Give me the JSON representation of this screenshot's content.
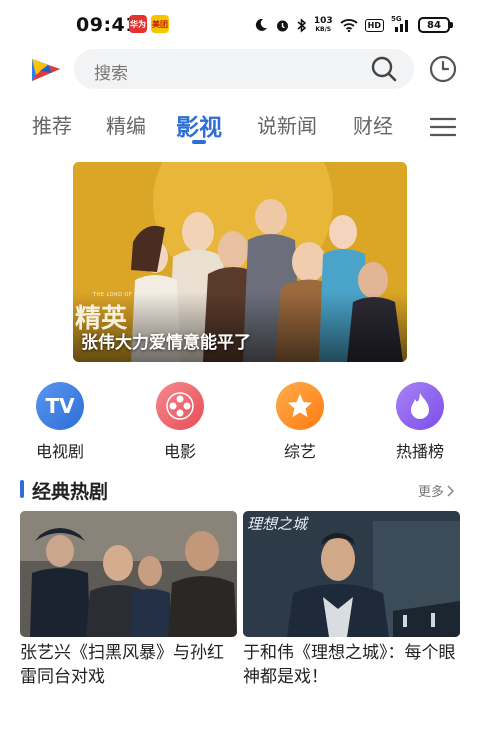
{
  "status_bar": {
    "time": "09:41",
    "badge1": "华为",
    "badge2": "美团",
    "net_speed_value": "103",
    "net_speed_unit": "KB/S",
    "hd": "HD",
    "signal": "5G",
    "battery": "84"
  },
  "header": {
    "search_placeholder": "搜索"
  },
  "tabs": [
    {
      "label": "推荐"
    },
    {
      "label": "精编"
    },
    {
      "label": "影视"
    },
    {
      "label": "说新闻"
    },
    {
      "label": "财经"
    }
  ],
  "active_tab": "影视",
  "banner": {
    "poster_text": "精英",
    "poster_subtext": "THE LORD OF ORDERS",
    "caption": "张伟大力爱情意能平了"
  },
  "categories": [
    {
      "label": "电视剧",
      "icon": "tv-icon",
      "glyph": "TV",
      "color": "#3e7be0"
    },
    {
      "label": "电影",
      "icon": "film-reel-icon",
      "glyph": "",
      "color": "#ee5a62"
    },
    {
      "label": "综艺",
      "icon": "star-icon",
      "glyph": "",
      "color": "#ff8a1e"
    },
    {
      "label": "热播榜",
      "icon": "flame-icon",
      "glyph": "",
      "color": "#8b5cf0"
    }
  ],
  "section": {
    "title": "经典热剧",
    "more": "更多"
  },
  "cards": [
    {
      "title": "张艺兴《扫黑风暴》与孙红雷同台对戏"
    },
    {
      "title": "于和伟《理想之城》：每个眼神都是戏！",
      "poster_text": "理想之城"
    }
  ],
  "colors": {
    "accent": "#2d6fd6",
    "search_bg": "#f2f3f5"
  }
}
